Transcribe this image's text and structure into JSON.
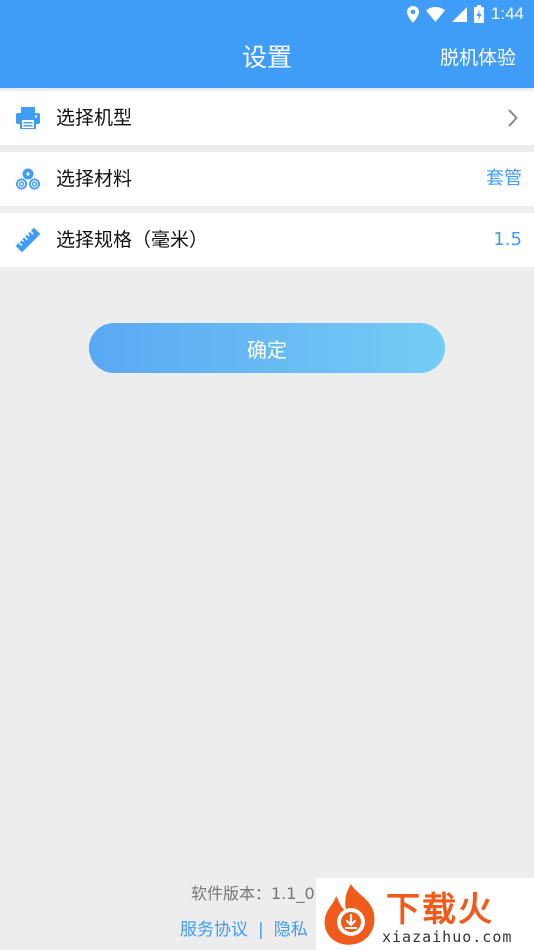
{
  "status_bar": {
    "time": "1:44",
    "icons": [
      "location-icon",
      "wifi-icon",
      "signal-icon",
      "battery-charging-icon"
    ]
  },
  "app_bar": {
    "title": "设置",
    "action_label": "脱机体验"
  },
  "settings": [
    {
      "icon": "printer-icon",
      "label": "选择机型",
      "value": ""
    },
    {
      "icon": "material-rolls-icon",
      "label": "选择材料",
      "value": "套管"
    },
    {
      "icon": "ruler-icon",
      "label": "选择规格（毫米）",
      "value": "1.5"
    }
  ],
  "confirm_label": "确定",
  "footer": {
    "version_text": "软件版本：1.1_0",
    "service_agreement": "服务协议",
    "separator": "|",
    "privacy_partial": "隐私"
  },
  "watermark": {
    "text_cn": "下载火",
    "text_en": "xiazaihuo.com"
  },
  "colors": {
    "primary": "#3f9cf7",
    "background": "#ededed",
    "button_gradient_start": "#5aa8f4",
    "button_gradient_end": "#74cdf5",
    "watermark_orange": "#f05a1a"
  }
}
